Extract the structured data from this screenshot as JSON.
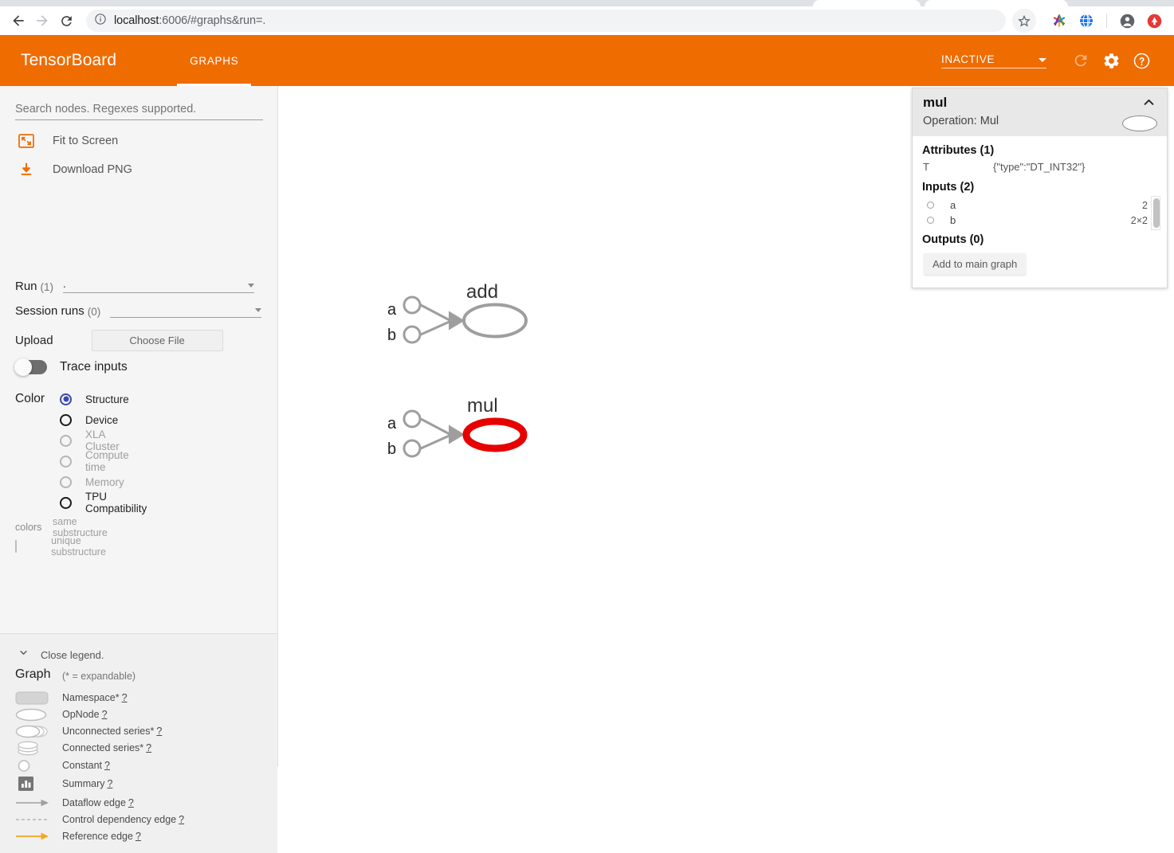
{
  "browser": {
    "back_icon": "back-arrow-icon",
    "forward_icon": "forward-arrow-icon",
    "reload_icon": "reload-icon",
    "info_icon": "page-info-icon",
    "url_host": "localhost",
    "url_rest": ":6006/#graphs&run=.",
    "star_icon": "bookmark-star-icon",
    "ext1_icon": "extension-asterisk-icon",
    "ext2_icon": "extension-globe-icon",
    "profile_icon": "profile-avatar-icon",
    "app_icon": "app-badge-icon"
  },
  "header": {
    "logo": "TensorBoard",
    "tabs": [
      {
        "label": "GRAPHS",
        "active": true
      }
    ],
    "run_state": "INACTIVE",
    "reload_icon": "reload-icon",
    "settings_icon": "gear-icon",
    "help_icon": "help-circle-icon",
    "background": "#ef6c00"
  },
  "sidebar": {
    "search": {
      "placeholder": "Search nodes. Regexes supported.",
      "value": ""
    },
    "actions": [
      {
        "label": "Fit to Screen",
        "icon": "fit-to-screen-icon"
      },
      {
        "label": "Download PNG",
        "icon": "download-icon"
      }
    ],
    "run": {
      "label": "Run",
      "count": "(1)",
      "value": "."
    },
    "session_runs": {
      "label": "Session runs",
      "count": "(0)",
      "value": ""
    },
    "upload": {
      "label": "Upload",
      "button": "Choose File"
    },
    "trace_inputs": {
      "label": "Trace inputs",
      "enabled": false
    },
    "color": {
      "label": "Color",
      "options": [
        {
          "label": "Structure",
          "selected": true,
          "disabled": false
        },
        {
          "label": "Device",
          "selected": false,
          "disabled": false
        },
        {
          "label": "XLA Cluster",
          "selected": false,
          "disabled": true
        },
        {
          "label": "Compute time",
          "selected": false,
          "disabled": true
        },
        {
          "label": "Memory",
          "selected": false,
          "disabled": true
        },
        {
          "label": "TPU Compatibility",
          "selected": false,
          "disabled": false
        }
      ],
      "colors_key": "colors",
      "same_substructure": "same substructure",
      "unique_substructure": "unique substructure"
    }
  },
  "legend": {
    "close_label": "Close legend.",
    "close_icon": "chevron-down-icon",
    "title": "Graph",
    "note": "(* = expandable)",
    "items": [
      {
        "label": "Namespace*",
        "help": "?",
        "icon": "namespace-shape-icon"
      },
      {
        "label": "OpNode",
        "help": "?",
        "icon": "opnode-shape-icon"
      },
      {
        "label": "Unconnected series*",
        "help": "?",
        "icon": "unconnected-series-shape-icon"
      },
      {
        "label": "Connected series*",
        "help": "?",
        "icon": "connected-series-shape-icon"
      },
      {
        "label": "Constant",
        "help": "?",
        "icon": "constant-shape-icon"
      },
      {
        "label": "Summary",
        "help": "?",
        "icon": "summary-shape-icon"
      },
      {
        "label": "Dataflow edge",
        "help": "?",
        "icon": "dataflow-edge-icon"
      },
      {
        "label": "Control dependency edge",
        "help": "?",
        "icon": "control-dependency-edge-icon"
      },
      {
        "label": "Reference edge",
        "help": "?",
        "icon": "reference-edge-icon"
      }
    ]
  },
  "graph": {
    "nodes": [
      {
        "name": "add",
        "selected": false,
        "inputs": [
          "a",
          "b"
        ]
      },
      {
        "name": "mul",
        "selected": true,
        "inputs": [
          "a",
          "b"
        ]
      }
    ],
    "selected_color": "#e60000",
    "edge_color": "#9e9e9e"
  },
  "info_card": {
    "title": "mul",
    "subtitle": "Operation: Mul",
    "collapse_icon": "chevron-up-icon",
    "attributes": {
      "heading": "Attributes (1)",
      "rows": [
        {
          "key": "T",
          "value": "{\"type\":\"DT_INT32\"}"
        }
      ]
    },
    "inputs": {
      "heading": "Inputs (2)",
      "rows": [
        {
          "name": "a",
          "shape": "2"
        },
        {
          "name": "b",
          "shape": "2×2"
        }
      ]
    },
    "outputs": {
      "heading": "Outputs (0)",
      "rows": []
    },
    "add_button": "Add to main graph"
  }
}
